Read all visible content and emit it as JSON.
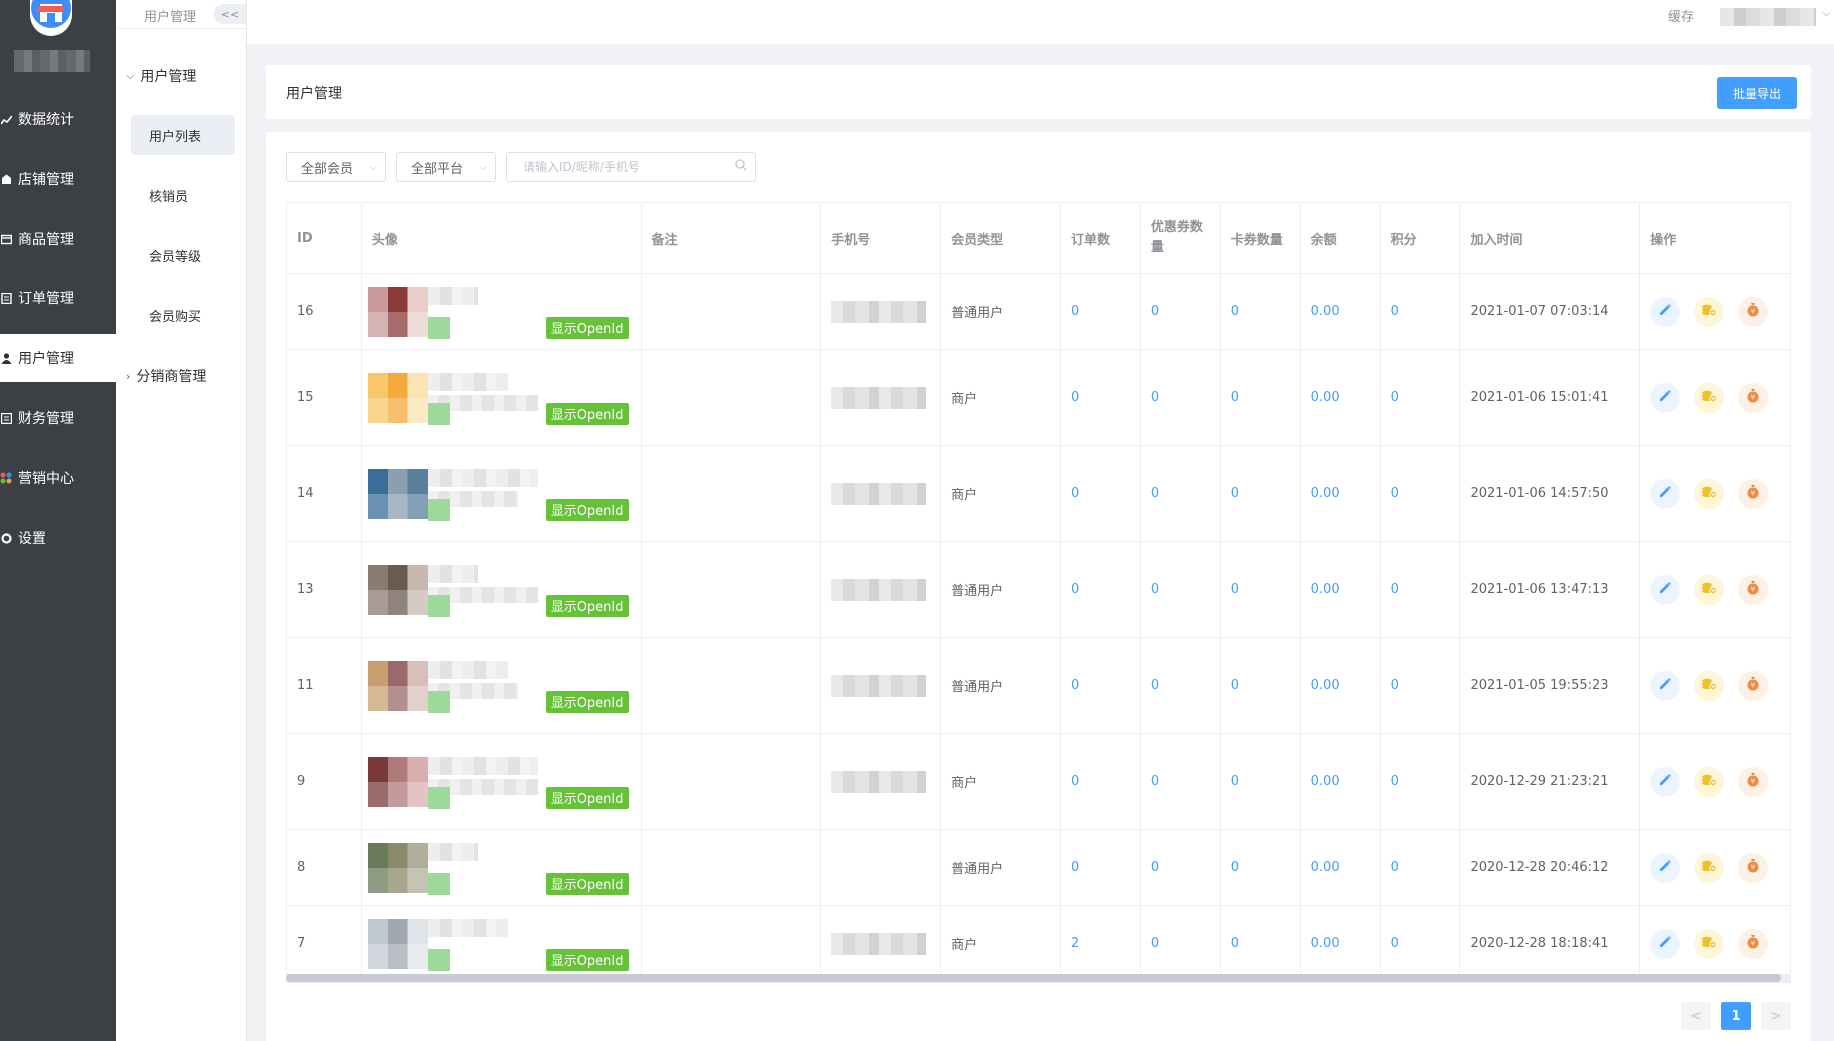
{
  "sidebar": {
    "items": [
      {
        "label": "数据统计",
        "icon": "chart-icon",
        "active": false
      },
      {
        "label": "店铺管理",
        "icon": "store-icon",
        "active": false
      },
      {
        "label": "商品管理",
        "icon": "product-icon",
        "active": false
      },
      {
        "label": "订单管理",
        "icon": "order-icon",
        "active": false
      },
      {
        "label": "用户管理",
        "icon": "user-icon",
        "active": true
      },
      {
        "label": "财务管理",
        "icon": "finance-icon",
        "active": false
      },
      {
        "label": "营销中心",
        "icon": "marketing-icon",
        "active": false
      },
      {
        "label": "设置",
        "icon": "gear-icon",
        "active": false
      }
    ]
  },
  "submenu": {
    "breadcrumb": "用户管理",
    "collapse_label": "<<",
    "group_user": "用户管理",
    "items": [
      "用户列表",
      "核销员",
      "会员等级",
      "会员购买"
    ],
    "group_distributor": "分销商管理"
  },
  "topbar": {
    "cache_label": "缓存"
  },
  "page": {
    "title": "用户管理",
    "export_label": "批量导出"
  },
  "filters": {
    "member": "全部会员",
    "platform": "全部平台",
    "search_placeholder": "请输入ID/昵称/手机号"
  },
  "table": {
    "headers": [
      "ID",
      "头像",
      "备注",
      "手机号",
      "会员类型",
      "订单数",
      "优惠券数量",
      "卡券数量",
      "余额",
      "积分",
      "加入时间",
      "操作"
    ],
    "openid_label": "显示OpenId",
    "rows": [
      {
        "id": "16",
        "type": "普通用户",
        "orders": "0",
        "coupons": "0",
        "cards": "0",
        "balance": "0.00",
        "points": "0",
        "joined": "2021-01-07 07:03:14"
      },
      {
        "id": "15",
        "type": "商户",
        "orders": "0",
        "coupons": "0",
        "cards": "0",
        "balance": "0.00",
        "points": "0",
        "joined": "2021-01-06 15:01:41"
      },
      {
        "id": "14",
        "type": "商户",
        "orders": "0",
        "coupons": "0",
        "cards": "0",
        "balance": "0.00",
        "points": "0",
        "joined": "2021-01-06 14:57:50"
      },
      {
        "id": "13",
        "type": "普通用户",
        "orders": "0",
        "coupons": "0",
        "cards": "0",
        "balance": "0.00",
        "points": "0",
        "joined": "2021-01-06 13:47:13"
      },
      {
        "id": "11",
        "type": "普通用户",
        "orders": "0",
        "coupons": "0",
        "cards": "0",
        "balance": "0.00",
        "points": "0",
        "joined": "2021-01-05 19:55:23"
      },
      {
        "id": "9",
        "type": "商户",
        "orders": "0",
        "coupons": "0",
        "cards": "0",
        "balance": "0.00",
        "points": "0",
        "joined": "2020-12-29 21:23:21"
      },
      {
        "id": "8",
        "type": "普通用户",
        "orders": "0",
        "coupons": "0",
        "cards": "0",
        "balance": "0.00",
        "points": "0",
        "joined": "2020-12-28 20:46:12"
      },
      {
        "id": "7",
        "type": "商户",
        "orders": "2",
        "coupons": "0",
        "cards": "0",
        "balance": "0.00",
        "points": "0",
        "joined": "2020-12-28 18:18:41"
      }
    ]
  },
  "pagination": {
    "current": "1",
    "prev": "<",
    "next": ">"
  },
  "colors": {
    "sidebar_bg": "#3c3f44",
    "primary": "#409eff",
    "success": "#67c23a",
    "warning": "#e6a23c",
    "money": "#f0883e"
  }
}
